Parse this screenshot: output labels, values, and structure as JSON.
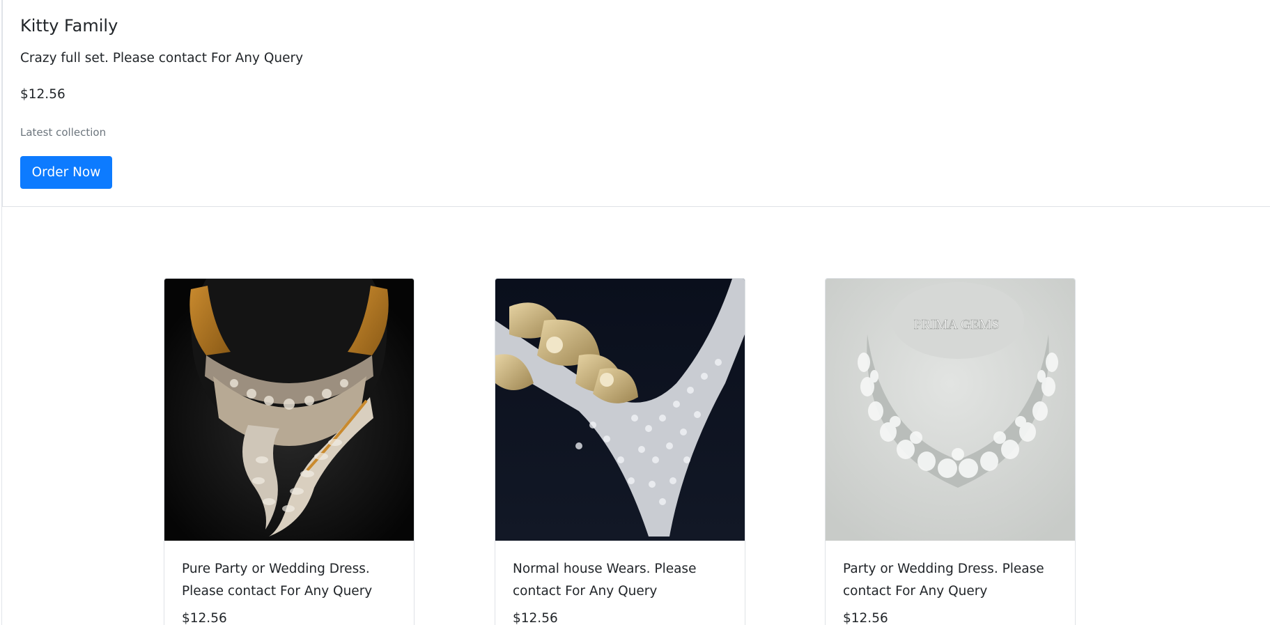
{
  "feature": {
    "title": "Kitty Family",
    "description": "Crazy full set. Please contact For Any Query",
    "price": "$12.56",
    "note": "Latest collection",
    "order_label": "Order Now"
  },
  "products": [
    {
      "image_icon": "gold-diamond-necklace-image",
      "image_watermark": "",
      "description": "Pure Party or Wedding Dress. Please contact For Any Query",
      "price": "$12.56"
    },
    {
      "image_icon": "floral-diamond-necklace-image",
      "image_watermark": "",
      "description": "Normal house Wears. Please contact For Any Query",
      "price": "$12.56"
    },
    {
      "image_icon": "diamond-flower-necklace-image",
      "image_watermark": "PRIMA GEMS",
      "description": "Party or Wedding Dress. Please contact For Any Query",
      "price": "$12.56"
    }
  ],
  "colors": {
    "primary": "#0d7bff",
    "muted_text": "#6c757d",
    "border": "#dfe2e6"
  }
}
